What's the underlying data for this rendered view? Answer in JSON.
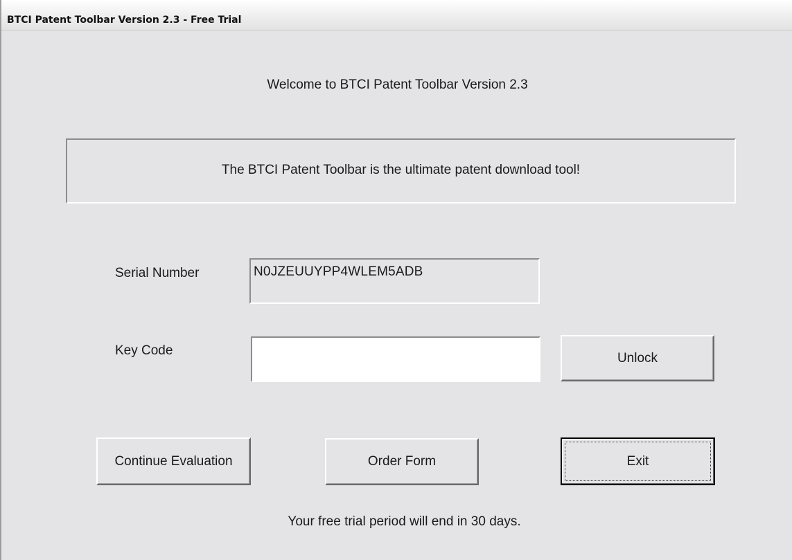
{
  "window": {
    "title": "BTCI Patent Toolbar Version 2.3 - Free Trial"
  },
  "welcome_text": "Welcome to BTCI Patent Toolbar Version 2.3",
  "banner_text": "The BTCI Patent Toolbar is the ultimate patent download tool!",
  "serial": {
    "label": "Serial Number",
    "value": "N0JZEUUYPP4WLEM5ADB"
  },
  "key_code": {
    "label": "Key Code",
    "value": ""
  },
  "buttons": {
    "unlock": "Unlock",
    "continue_evaluation": "Continue Evaluation",
    "order_form": "Order Form",
    "exit": "Exit"
  },
  "trial_notice": "Your free trial period will end in 30 days."
}
